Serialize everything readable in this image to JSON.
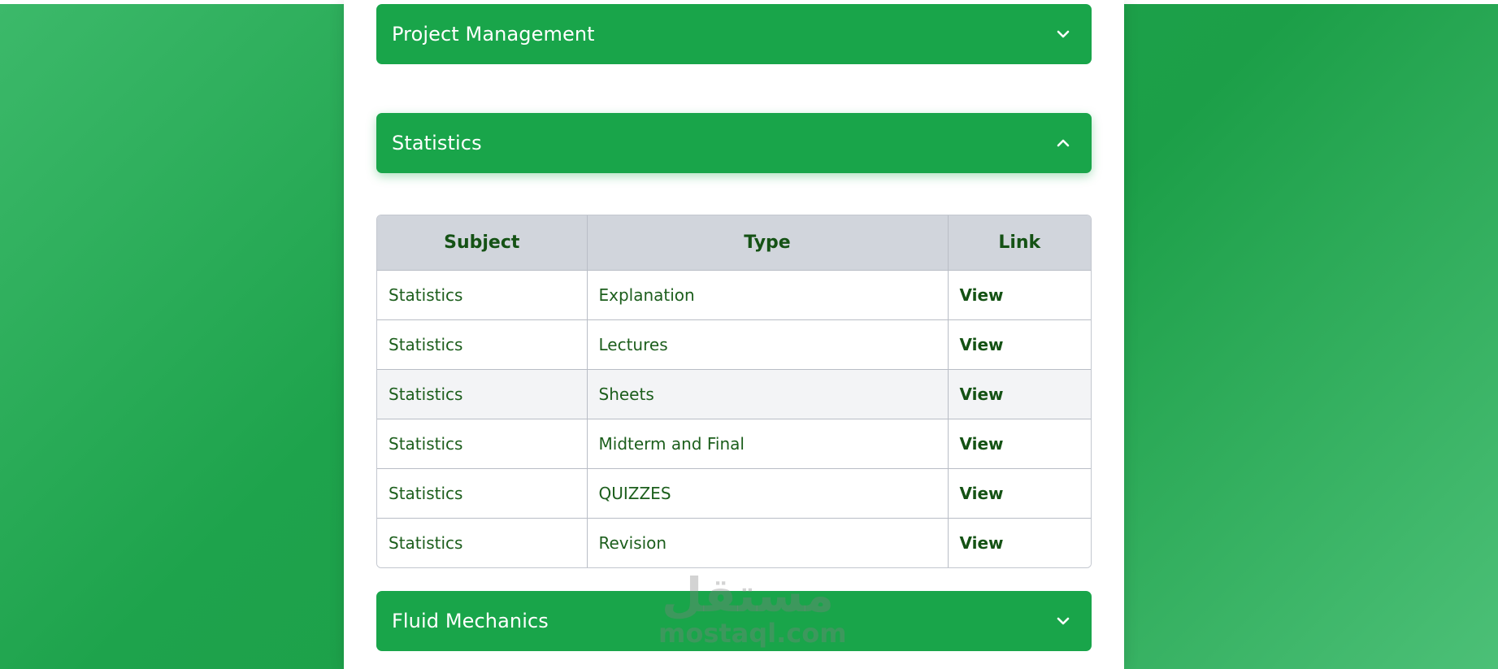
{
  "accordion": {
    "sections": [
      {
        "title": "Project Management",
        "state": "collapsed"
      },
      {
        "title": "Statistics",
        "state": "expanded"
      },
      {
        "title": "Fluid Mechanics",
        "state": "collapsed"
      }
    ]
  },
  "table": {
    "headers": [
      "Subject",
      "Type",
      "Link"
    ],
    "rows": [
      {
        "subject": "Statistics",
        "type": "Explanation",
        "link": "View"
      },
      {
        "subject": "Statistics",
        "type": "Lectures",
        "link": "View"
      },
      {
        "subject": "Statistics",
        "type": "Sheets",
        "link": "View"
      },
      {
        "subject": "Statistics",
        "type": "Midterm and Final",
        "link": "View"
      },
      {
        "subject": "Statistics",
        "type": "QUIZZES",
        "link": "View"
      },
      {
        "subject": "Statistics",
        "type": "Revision",
        "link": "View"
      }
    ]
  },
  "watermark": {
    "arabic": "مستقل",
    "latin": "mostaql.com"
  },
  "icons": {
    "collapsed": "chevron-down-icon",
    "expanded": "chevron-up-icon"
  },
  "colors": {
    "accent": "#19a54a",
    "header_bg": "#d1d5dc",
    "text_green": "#1c5e1c"
  }
}
